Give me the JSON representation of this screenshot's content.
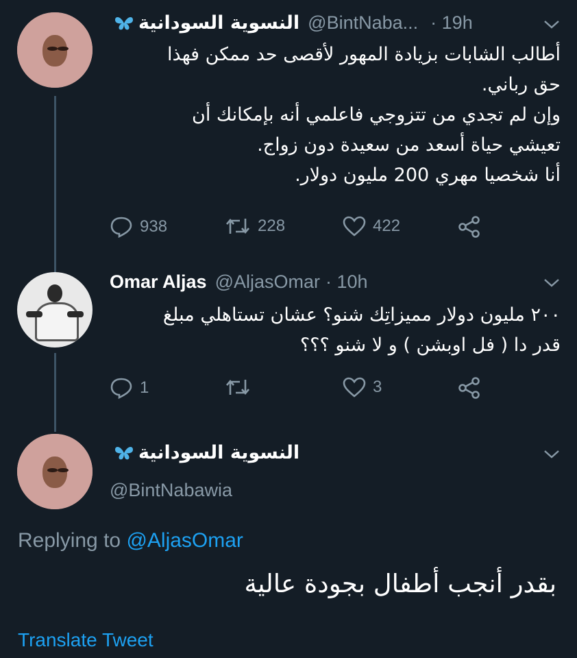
{
  "tweet1": {
    "display_name": "النسوية السودانية",
    "handle": "@BintNaba...",
    "time": "· 19h",
    "lines": [
      "أطالب الشابات بزيادة المهور لأقصى حد ممكن فهذا",
      "حق رباني.",
      "وإن لم تجدي من تتزوجي فاعلمي أنه بإمكانك أن",
      "تعيشي حياة أسعد من سعيدة دون زواج.",
      "أنا شخصيا مهري 200 مليون دولار."
    ],
    "replies": "938",
    "retweets": "228",
    "likes": "422"
  },
  "tweet2": {
    "display_name": "Omar Aljas",
    "handle": "@AljasOmar",
    "time": "· 10h",
    "lines": [
      "٢٠٠ مليون دولار مميزاتِك شنو؟ عشان تستاهلي مبلغ",
      "قدر دا ( فل اوبشن ) و لا شنو ؟؟؟"
    ],
    "replies": "1",
    "retweets": "",
    "likes": "3"
  },
  "main_tweet": {
    "display_name": "النسوية السودانية",
    "handle": "@BintNabawia",
    "replying_prefix": "Replying to",
    "replying_handle": "@AljasOmar",
    "text": "بقدر أنجب أطفال بجودة عالية",
    "translate_label": "Translate Tweet"
  },
  "colors": {
    "background": "#141d26",
    "secondary_text": "#8899a6",
    "link": "#1da1f2",
    "butterfly": "#4fb3e8"
  },
  "icons": [
    "reply-icon",
    "retweet-icon",
    "like-icon",
    "share-icon",
    "butterfly-icon",
    "chevron-down-icon"
  ]
}
